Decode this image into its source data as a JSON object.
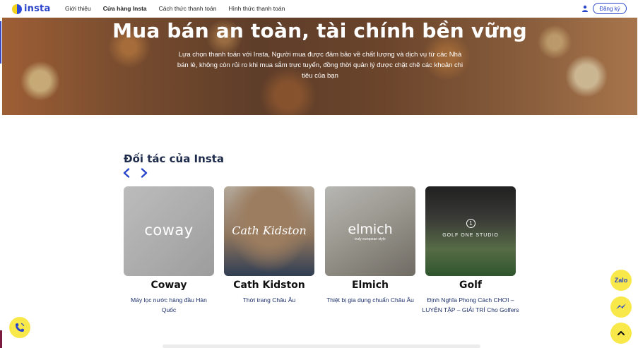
{
  "nav": {
    "logo_text": "insta",
    "links": [
      {
        "label": "Giới thiệu"
      },
      {
        "label": "Cửa hàng Insta"
      },
      {
        "label": "Cách thức thanh toán"
      },
      {
        "label": "Hình thức thanh toán"
      }
    ],
    "signup_label": "Đăng ký"
  },
  "hero": {
    "title": "Mua bán an toàn, tài chính bền vững",
    "description": "Lựa chọn thanh toán với Insta, Người mua được đảm bảo về chất lượng và dịch vụ từ các Nhà bán lẻ, không còn rủi ro khi mua sắm trực tuyến, đồng thời quản lý được chặt chẽ các khoản chi tiêu của bạn"
  },
  "partners": {
    "title": "Đối tác của Insta",
    "cards": [
      {
        "logo_text": "coway",
        "name": "Coway",
        "description": "Máy lọc nước hàng đầu Hàn Quốc"
      },
      {
        "logo_text": "Cath Kidston",
        "name": "Cath Kidston",
        "description": "Thời trang Châu Âu"
      },
      {
        "logo_text": "elmich",
        "logo_tagline": "truly european style",
        "name": "Elmich",
        "description": "Thiệt bị gia dụng chuẩn Châu Âu"
      },
      {
        "logo_badge": "1",
        "logo_text": "GOLF ONE STUDIO",
        "name": "Golf",
        "description": "Định Nghĩa Phong Cách CHƠI – LUYỆN TẬP – GIẢI TRÍ Cho Golfers"
      }
    ]
  },
  "floating": {
    "zalo_label": "Zalo"
  },
  "colors": {
    "brand_blue": "#2a45c9",
    "float_yellow": "#f8e84a",
    "title_navy": "#1d2a4a"
  },
  "icons": [
    "user-icon",
    "chevron-left-icon",
    "chevron-right-icon",
    "messenger-icon",
    "chevron-up-icon",
    "phone-icon"
  ]
}
